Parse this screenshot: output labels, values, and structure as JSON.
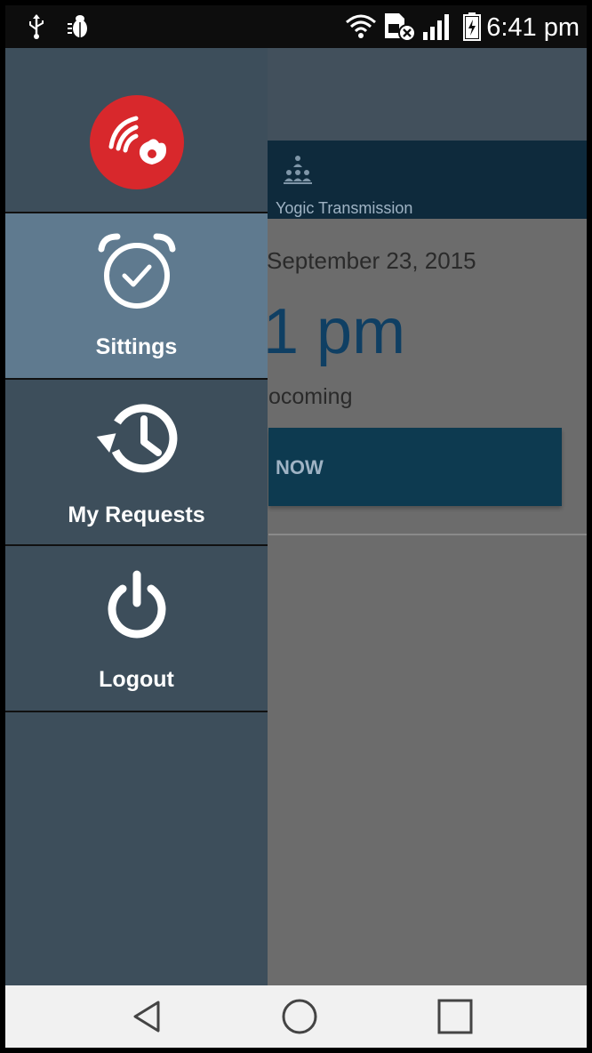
{
  "status_bar": {
    "time": "6:41 pm",
    "icons": [
      "usb-icon",
      "debug-icon",
      "wifi-icon",
      "sim-icon",
      "signal-icon",
      "battery-icon"
    ]
  },
  "background_screen": {
    "brand": "Yogic Transmission",
    "date": "September 23, 2015",
    "time_partial": "1 pm",
    "status_partial": "ocoming",
    "button_partial": "NOW"
  },
  "drawer": {
    "logo_icon": "app-logo-icon",
    "items": [
      {
        "label": "Sittings",
        "icon": "alarm-clock-icon",
        "active": true
      },
      {
        "label": "My Requests",
        "icon": "history-icon",
        "active": false
      },
      {
        "label": "Logout",
        "icon": "power-icon",
        "active": false
      }
    ]
  },
  "nav_bar": {
    "icons": [
      "back-icon",
      "home-icon",
      "recents-icon"
    ]
  },
  "colors": {
    "drawer_bg": "#3d4e5b",
    "drawer_active": "#5f7a8f",
    "logo_red": "#d8282c",
    "header_band": "#0e2a3c",
    "accent_blue": "#0f3f63"
  }
}
